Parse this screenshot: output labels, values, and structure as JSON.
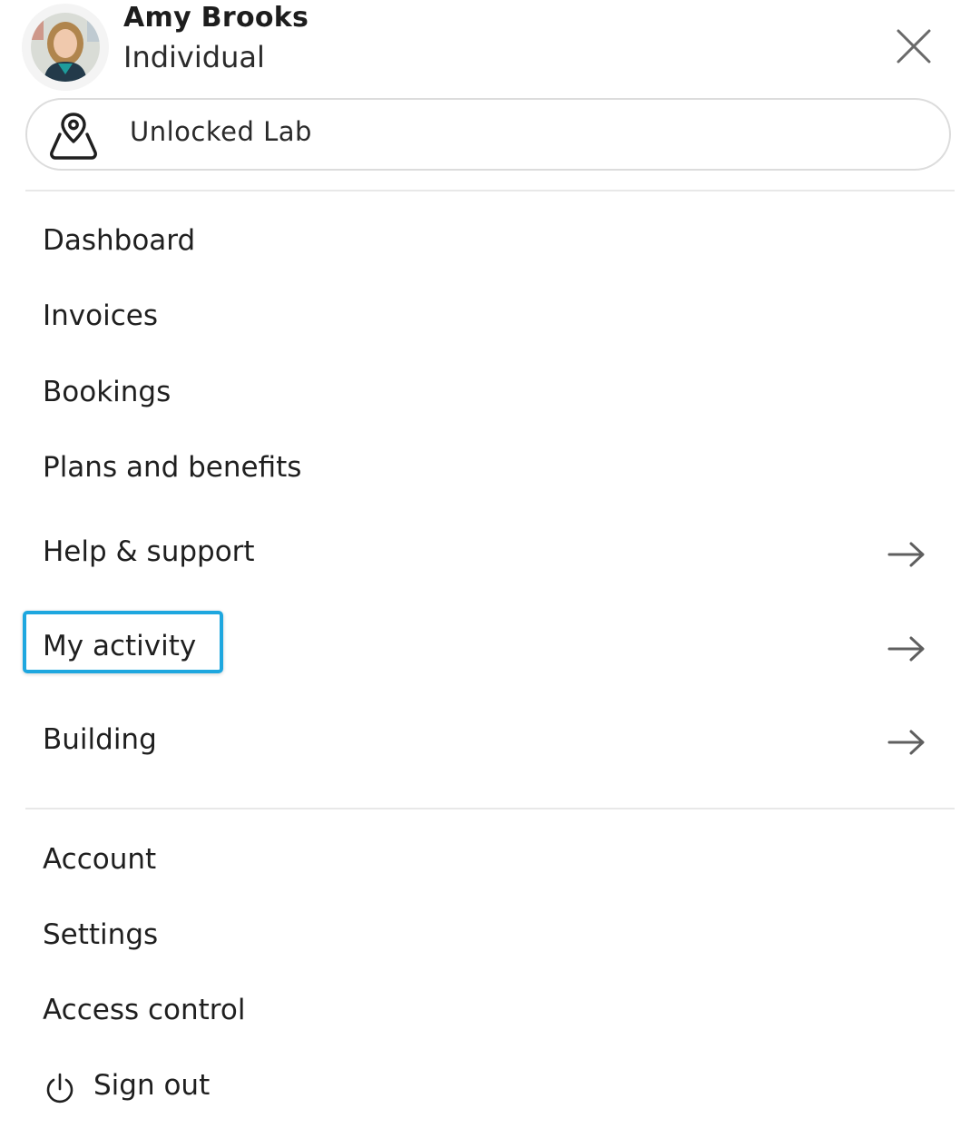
{
  "user": {
    "name": "Amy Brooks",
    "account_type": "Individual",
    "avatar_icon": "user-avatar-photo"
  },
  "header": {
    "close_icon": "close-icon"
  },
  "location": {
    "label": "Unlocked Lab",
    "icon": "location-pin-icon"
  },
  "menu_primary": [
    {
      "label": "Dashboard",
      "has_arrow": false
    },
    {
      "label": "Invoices",
      "has_arrow": false
    },
    {
      "label": "Bookings",
      "has_arrow": false
    },
    {
      "label": "Plans and benefits",
      "has_arrow": false
    },
    {
      "label": "Help & support",
      "has_arrow": true
    },
    {
      "label": "My activity",
      "has_arrow": true,
      "highlighted": true
    },
    {
      "label": "Building",
      "has_arrow": true
    }
  ],
  "menu_secondary": [
    {
      "label": "Account"
    },
    {
      "label": "Settings"
    },
    {
      "label": "Access control"
    }
  ],
  "sign_out": {
    "label": "Sign out",
    "icon": "power-icon"
  },
  "colors": {
    "highlight": "#1ea7df",
    "text": "#1f1f1f",
    "divider": "#e8e8e8",
    "arrow": "#5f5f5f"
  }
}
